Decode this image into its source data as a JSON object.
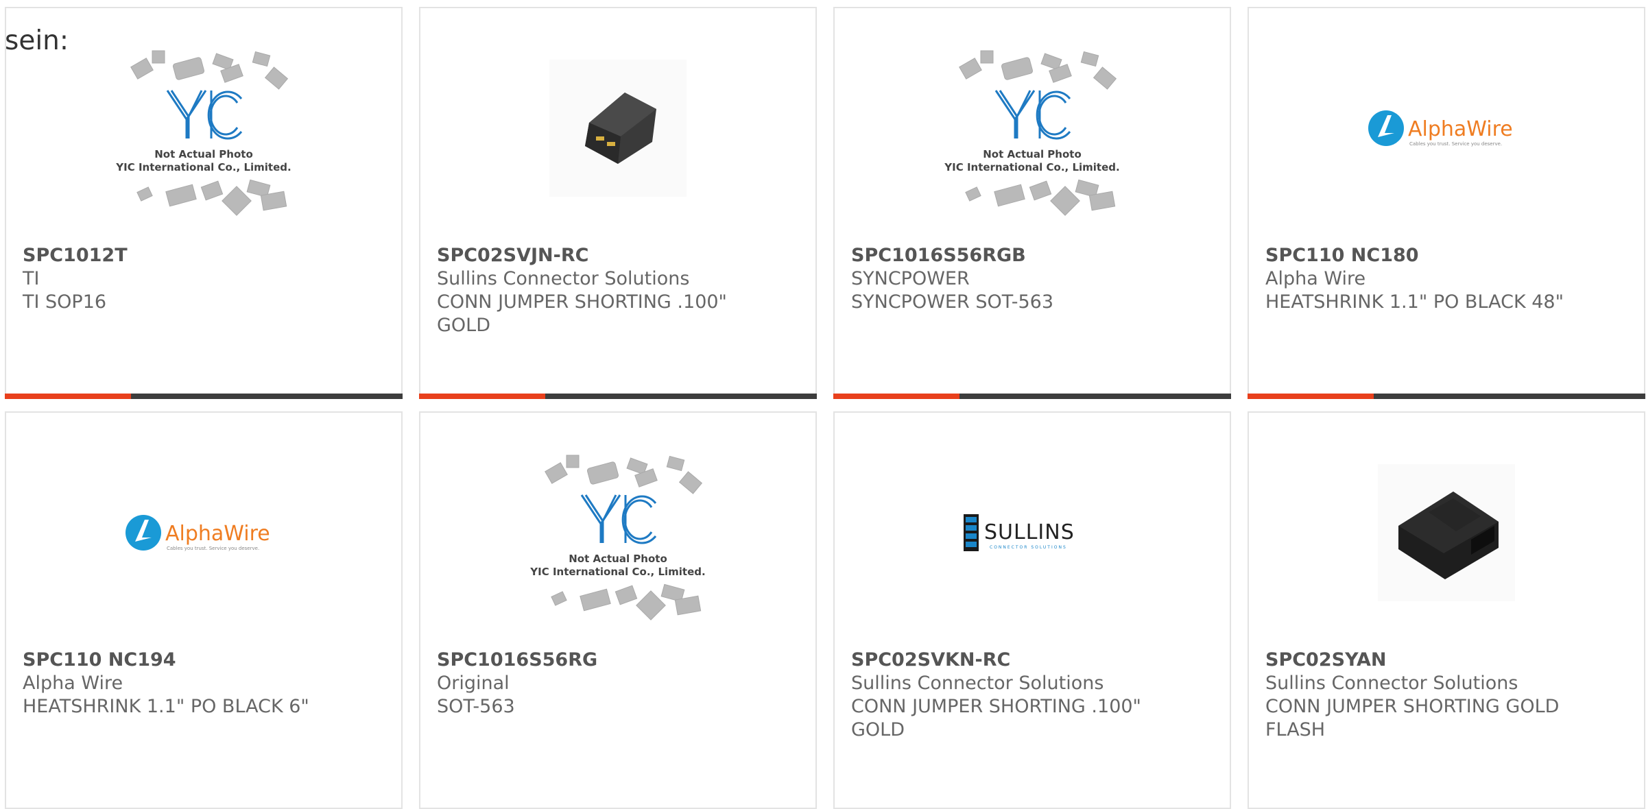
{
  "intro_text": "sein:",
  "colors": {
    "accent": "#e8401c",
    "bar": "#3d3d3d",
    "border": "#e3e3e3",
    "alpha_blue": "#1a9ad6",
    "alpha_orange": "#ef7d22",
    "sullins_blue": "#1a86c9"
  },
  "products": [
    {
      "part": "SPC1012T",
      "manufacturer": "TI",
      "description": "TI SOP16",
      "image": "yic-placeholder-icon",
      "placeholder_line1": "Not Actual Photo",
      "placeholder_line2": "YIC International Co., Limited.",
      "logo_text": "YIC"
    },
    {
      "part": "SPC02SVJN-RC",
      "manufacturer": "Sullins Connector Solutions",
      "description": "CONN JUMPER SHORTING .100\"\nGOLD",
      "image": "jumper-photo-icon"
    },
    {
      "part": "SPC1016S56RGB",
      "manufacturer": "SYNCPOWER",
      "description": "SYNCPOWER SOT-563",
      "image": "yic-placeholder-icon",
      "placeholder_line1": "Not Actual Photo",
      "placeholder_line2": "YIC International Co., Limited.",
      "logo_text": "YIC"
    },
    {
      "part": "SPC110 NC180",
      "manufacturer": "Alpha Wire",
      "description": "HEATSHRINK 1.1\" PO BLACK 48\"",
      "image": "alphawire-logo-icon",
      "brand_name": "AlphaWire",
      "tagline": "Cables you trust. Service you deserve."
    },
    {
      "part": "SPC110 NC194",
      "manufacturer": "Alpha Wire",
      "description": "HEATSHRINK 1.1\" PO BLACK 6\"",
      "image": "alphawire-logo-icon",
      "brand_name": "AlphaWire",
      "tagline": "Cables you trust. Service you deserve."
    },
    {
      "part": "SPC1016S56RG",
      "manufacturer": "Original",
      "description": "SOT-563",
      "image": "yic-placeholder-icon",
      "placeholder_line1": "Not Actual Photo",
      "placeholder_line2": "YIC International Co., Limited.",
      "logo_text": "YIC"
    },
    {
      "part": "SPC02SVKN-RC",
      "manufacturer": "Sullins Connector Solutions",
      "description": "CONN JUMPER SHORTING .100\"\nGOLD",
      "image": "sullins-logo-icon",
      "brand_name": "SULLINS",
      "tagline": "CONNECTOR SOLUTIONS"
    },
    {
      "part": "SPC02SYAN",
      "manufacturer": "Sullins Connector Solutions",
      "description": "CONN JUMPER SHORTING GOLD\nFLASH",
      "image": "jumper-photo-icon"
    }
  ]
}
